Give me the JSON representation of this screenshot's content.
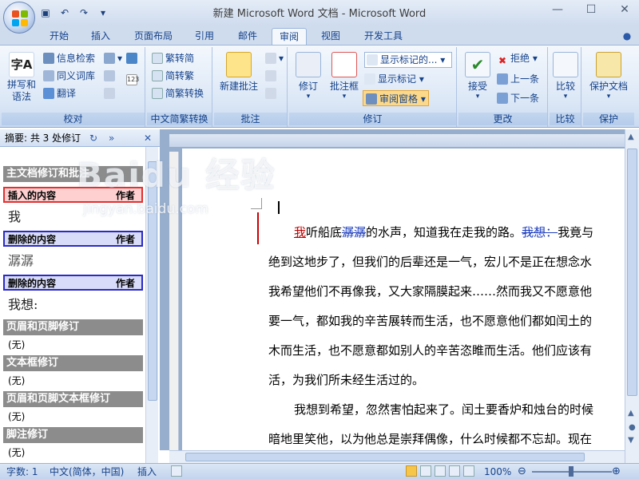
{
  "window": {
    "title": "新建 Microsoft Word 文档 - Microsoft Word",
    "controls": [
      "—",
      "☐",
      "✕"
    ]
  },
  "tabs": [
    "开始",
    "插入",
    "页面布局",
    "引用",
    "邮件",
    "审阅",
    "视图",
    "开发工具"
  ],
  "active_tab": "审阅",
  "ribbon": {
    "proofing": {
      "label": "校对",
      "spell_grammar": "拼写和\n语法",
      "research": "信息检索",
      "thesaurus": "同义词库",
      "translate": "翻译"
    },
    "chinese_conversion": {
      "label": "中文简繁转换",
      "to_traditional": "繁转简",
      "to_simplified": "简转繁",
      "conversion": "简繁转换"
    },
    "comments": {
      "label": "批注",
      "new_comment": "新建批注"
    },
    "tracking": {
      "label": "修订",
      "track_changes": "修订",
      "balloons": "批注框",
      "display_for_review": "显示标记的...",
      "show_markup": "显示标记",
      "reviewing_pane": "审阅窗格"
    },
    "changes": {
      "label": "更改",
      "accept": "接受",
      "reject": "拒绝",
      "previous": "上一条",
      "next": "下一条"
    },
    "compare": {
      "label": "比较",
      "compare": "比较"
    },
    "protect": {
      "label": "保护",
      "protect_document": "保护文档"
    }
  },
  "review_pane": {
    "header": "摘要: 共 3 处修订",
    "main_section": "主文档修订和批注",
    "entries": [
      {
        "type": "插入的内容",
        "author": "作者",
        "text": "我"
      },
      {
        "type": "删除的内容",
        "author": "作者",
        "text": "潺潺"
      },
      {
        "type": "删除的内容",
        "author": "作者",
        "text": "我想:"
      }
    ],
    "sections": [
      {
        "title": "页眉和页脚修订",
        "value": "(无)"
      },
      {
        "title": "文本框修订",
        "value": "(无)"
      },
      {
        "title": "页眉和页脚文本框修订",
        "value": "(无)"
      },
      {
        "title": "脚注修订",
        "value": "(无)"
      }
    ]
  },
  "document": {
    "line1_inserted": "我",
    "line1_a": "听船底",
    "line1_deleted": "潺潺",
    "line1_b": "的水声，知道我在走我的路。",
    "line1_deleted2": "我想：",
    "line1_c": "我竟与",
    "lines": [
      "绝到这地步了，但我们的后辈还是一气，宏儿不是正在想念水",
      "我希望他们不再像我，又大家隔膜起来……然而我又不愿意他",
      "要一气，都如我的辛苦展转而生活，也不愿意他们都如闰土的",
      "木而生活，也不愿意都如别人的辛苦恣睢而生活。他们应该有",
      "活，为我们所未经生活过的。"
    ],
    "para2": [
      "我想到希望，忽然害怕起来了。闰土要香炉和烛台的时候",
      "暗地里笑他，以为他总是崇拜偶像，什么时候都不忘却。现在"
    ]
  },
  "statusbar": {
    "word_count": "字数: 1",
    "language": "中文(简体，中国)",
    "mode": "插入",
    "zoom": "100%"
  },
  "watermark": {
    "main": "Baidu 经验",
    "sub": "jingyan.baidu.com"
  }
}
